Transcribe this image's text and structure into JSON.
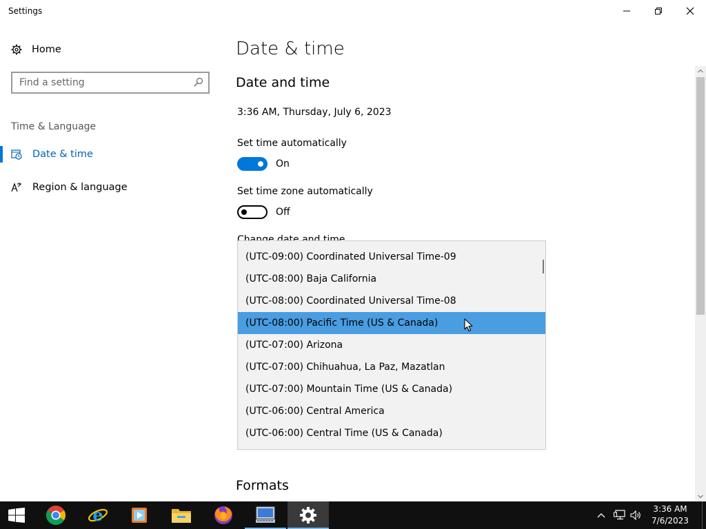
{
  "window": {
    "title": "Settings"
  },
  "sidebar": {
    "home_label": "Home",
    "search_placeholder": "Find a setting",
    "section_label": "Time & Language",
    "items": [
      {
        "label": "Date & time",
        "icon": "date-time-icon",
        "selected": true
      },
      {
        "label": "Region & language",
        "icon": "region-language-icon",
        "selected": false
      }
    ]
  },
  "main": {
    "title": "Date & time",
    "subheading": "Date and time",
    "current_time": "3:36 AM, Thursday, July 6, 2023",
    "set_time_auto": {
      "label": "Set time automatically",
      "state": "On"
    },
    "set_timezone_auto": {
      "label": "Set time zone automatically",
      "state": "Off"
    },
    "change_date_label": "Change date and time",
    "formats_heading": "Formats"
  },
  "timezone_dropdown": {
    "items": [
      "(UTC-09:00) Coordinated Universal Time-09",
      "(UTC-08:00) Baja California",
      "(UTC-08:00) Coordinated Universal Time-08",
      "(UTC-08:00) Pacific Time (US & Canada)",
      "(UTC-07:00) Arizona",
      "(UTC-07:00) Chihuahua, La Paz, Mazatlan",
      "(UTC-07:00) Mountain Time (US & Canada)",
      "(UTC-06:00) Central America",
      "(UTC-06:00) Central Time (US & Canada)"
    ],
    "selected": "(UTC-08:00) Pacific Time (US & Canada)"
  },
  "taskbar": {
    "apps": [
      "start-icon",
      "chrome-icon",
      "internet-explorer-icon",
      "media-player-icon",
      "file-explorer-icon",
      "firefox-icon",
      "remote-desktop-icon",
      "settings-icon"
    ],
    "active_app": "settings-icon",
    "clock_time": "3:36 AM",
    "clock_date": "7/6/2023"
  },
  "colors": {
    "accent": "#0078d7",
    "selected_item": "#4a9de0",
    "taskbar": "#101010"
  }
}
